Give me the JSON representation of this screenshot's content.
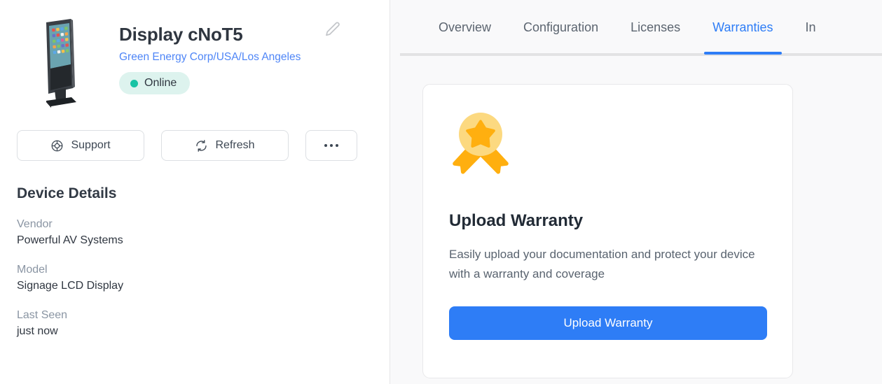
{
  "device": {
    "title": "Display cNoT5",
    "path": "Green Energy Corp/USA/Los Angeles",
    "status": "Online",
    "status_color": "#17c3a4",
    "status_bg": "#ddf3ee",
    "thumbnail_icon": "digital-signage-kiosk",
    "edit_icon": "pencil-icon"
  },
  "actions": {
    "support_label": "Support",
    "support_icon": "life-buoy-icon",
    "refresh_label": "Refresh",
    "refresh_icon": "refresh-icon",
    "more_icon": "ellipsis-icon"
  },
  "details": {
    "heading": "Device Details",
    "items": [
      {
        "label": "Vendor",
        "value": "Powerful AV Systems"
      },
      {
        "label": "Model",
        "value": "Signage LCD Display"
      },
      {
        "label": "Last Seen",
        "value": "just now"
      }
    ]
  },
  "tabs": {
    "items": [
      {
        "label": "Overview",
        "active": false
      },
      {
        "label": "Configuration",
        "active": false
      },
      {
        "label": "Licenses",
        "active": false
      },
      {
        "label": "Warranties",
        "active": true
      },
      {
        "label": "In",
        "active": false
      }
    ],
    "active_color": "#2e7df6"
  },
  "warranty_card": {
    "icon": "award-ribbon-icon",
    "icon_circle_color": "#fcd980",
    "icon_accent_color": "#ffaf0f",
    "title": "Upload Warranty",
    "description": "Easily upload your documentation and protect your device with a warranty and coverage",
    "button_label": "Upload Warranty",
    "button_color": "#2e7df6"
  }
}
